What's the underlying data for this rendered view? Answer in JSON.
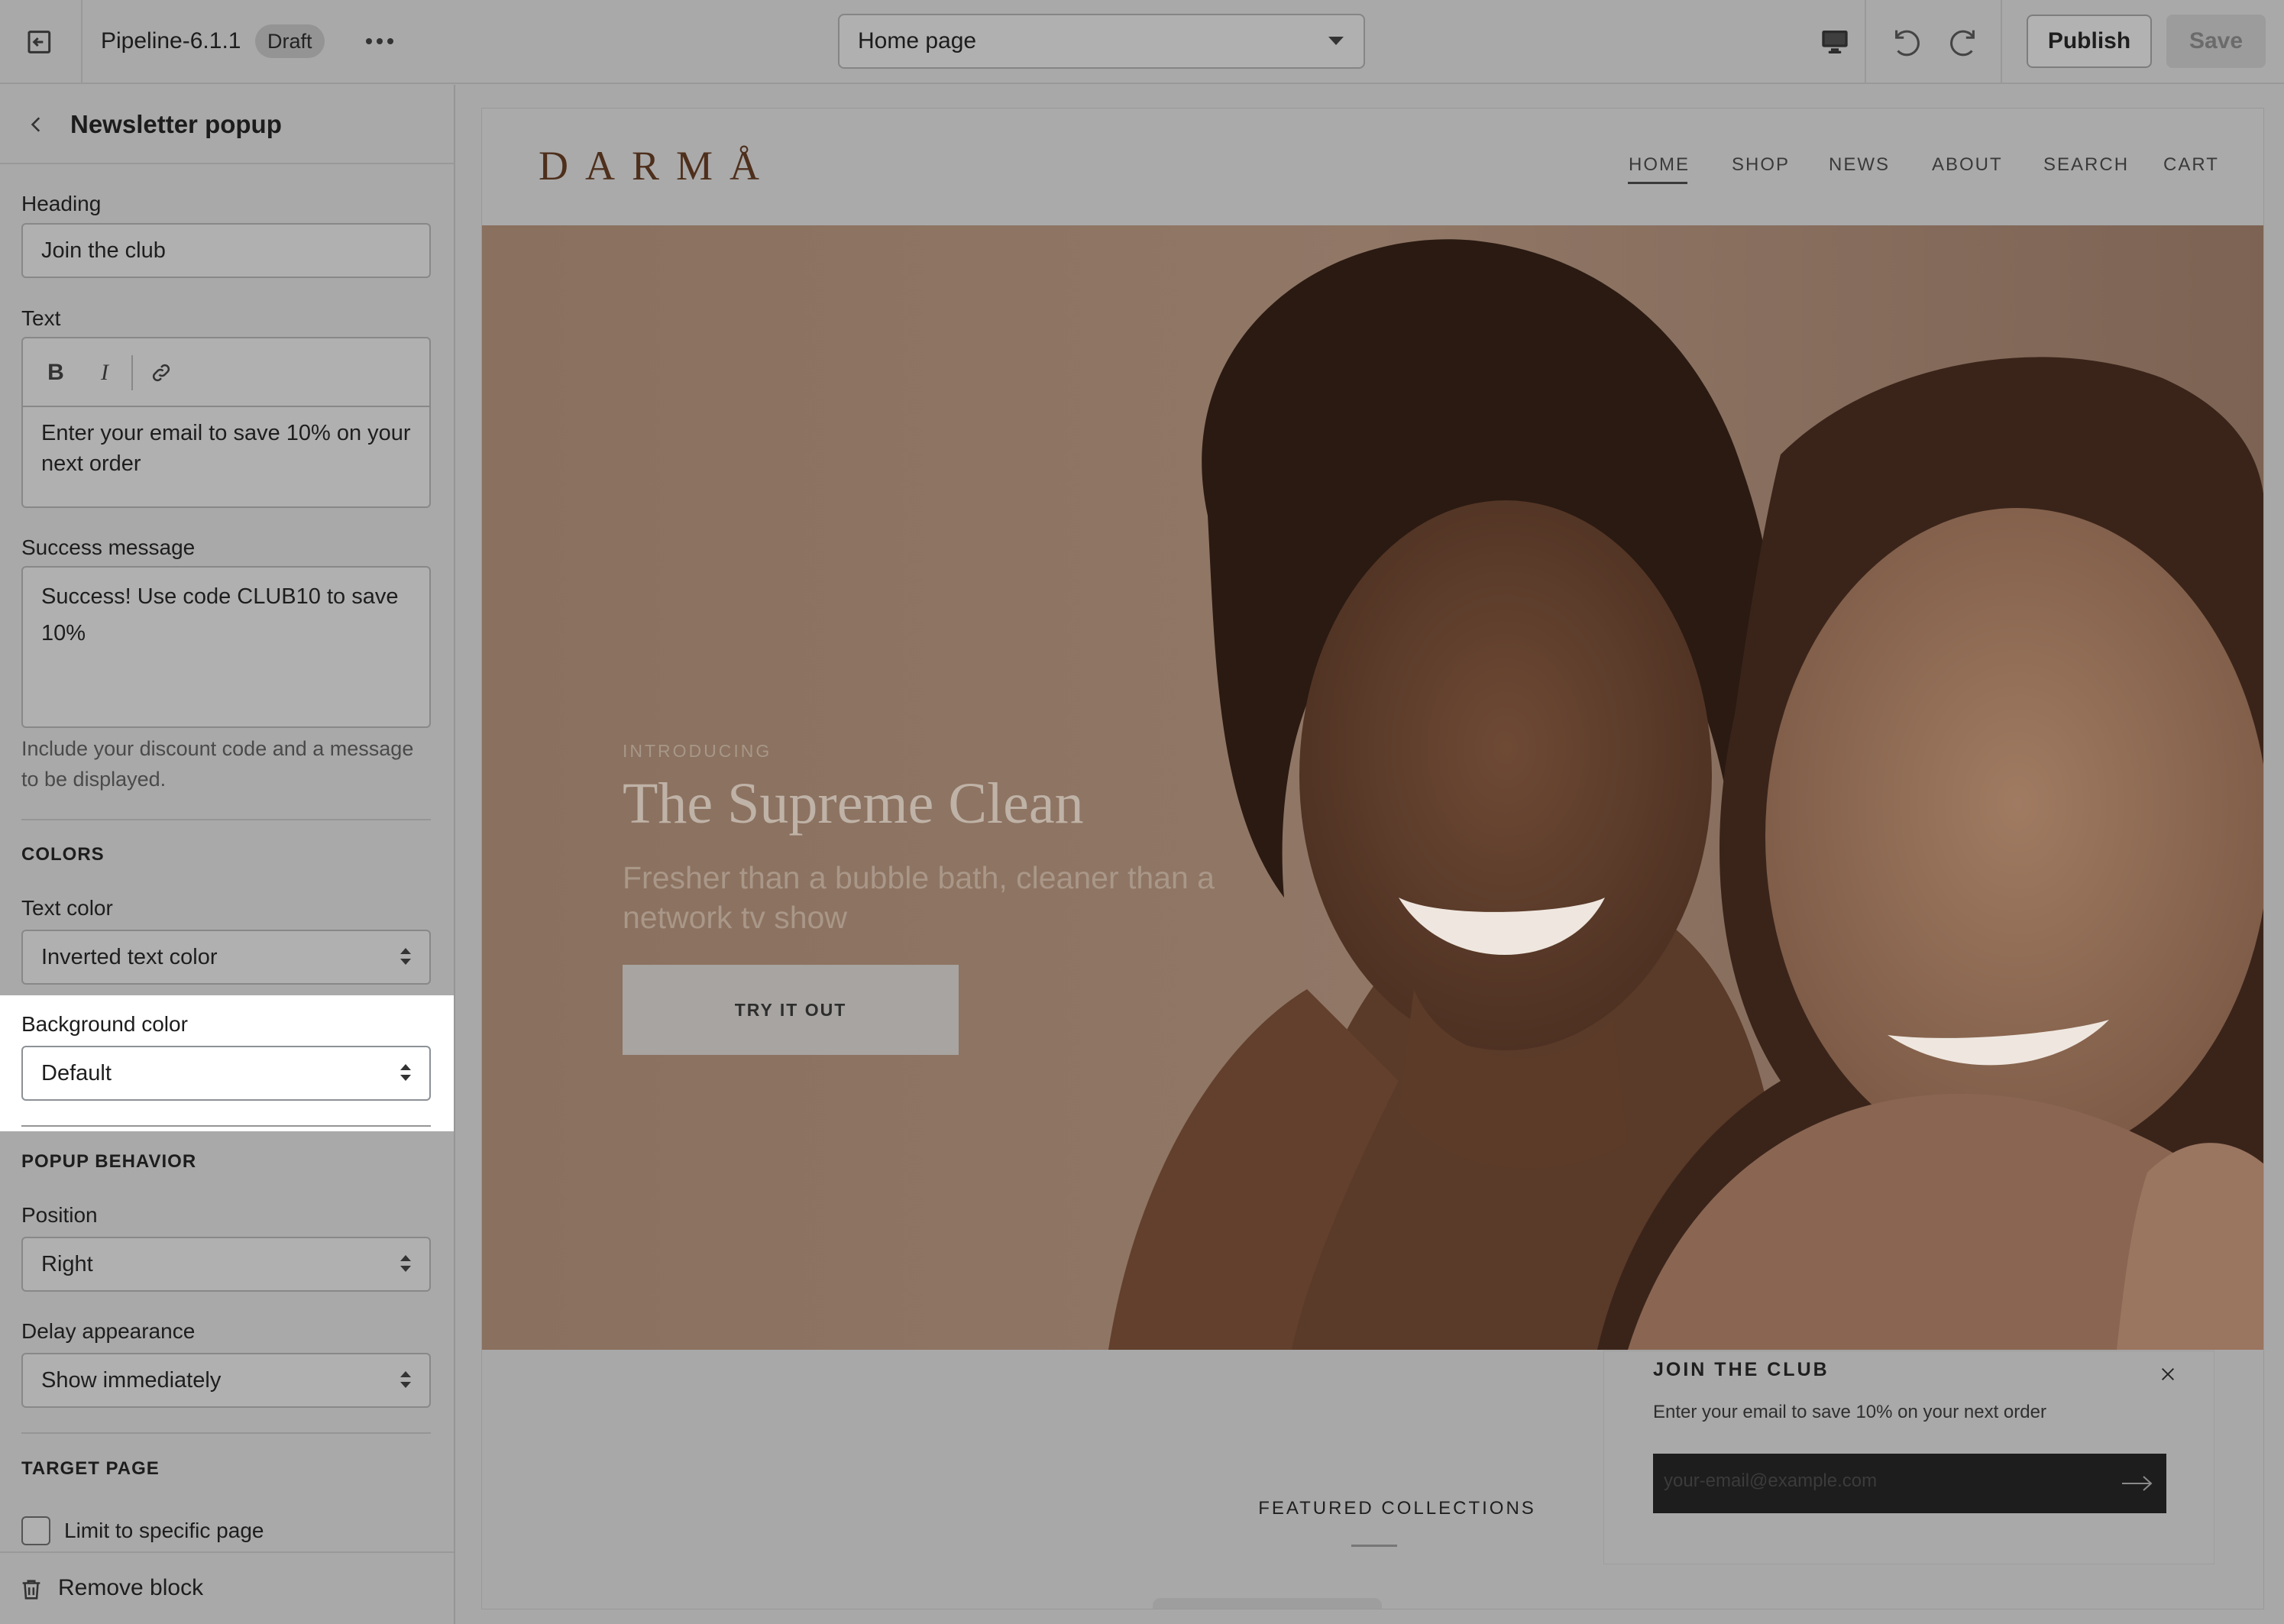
{
  "topbar": {
    "theme_name": "Pipeline-6.1.1",
    "badge": "Draft",
    "page_selector": "Home page",
    "publish_label": "Publish",
    "save_label": "Save"
  },
  "sidebar": {
    "title": "Newsletter popup",
    "heading_label": "Heading",
    "heading_value": "Join the club",
    "text_label": "Text",
    "text_value": "Enter your email to save 10% on your next order",
    "success_label": "Success message",
    "success_value": "Success! Use code CLUB10 to save 10%",
    "success_help": "Include your discount code and a message to be displayed.",
    "colors_section": "COLORS",
    "text_color_label": "Text color",
    "text_color_value": "Inverted text color",
    "bg_color_label": "Background color",
    "bg_color_value": "Default",
    "popup_section": "POPUP BEHAVIOR",
    "position_label": "Position",
    "position_value": "Right",
    "delay_label": "Delay appearance",
    "delay_value": "Show immediately",
    "target_section": "TARGET PAGE",
    "limit_label": "Limit to specific page",
    "remove_label": "Remove block"
  },
  "preview": {
    "logo": "DARMÅ",
    "nav": [
      "HOME",
      "SHOP",
      "NEWS",
      "ABOUT",
      "SEARCH",
      "CART"
    ],
    "eyebrow": "INTRODUCING",
    "hero_title": "The Supreme Clean",
    "hero_subtitle": "Fresher than a bubble bath, cleaner than a network tv show",
    "hero_button": "TRY IT OUT",
    "featured": "FEATURED COLLECTIONS",
    "popup_title": "JOIN THE CLUB",
    "popup_text": "Enter your email to save 10% on your next order",
    "popup_placeholder": "your-email@example.com"
  }
}
